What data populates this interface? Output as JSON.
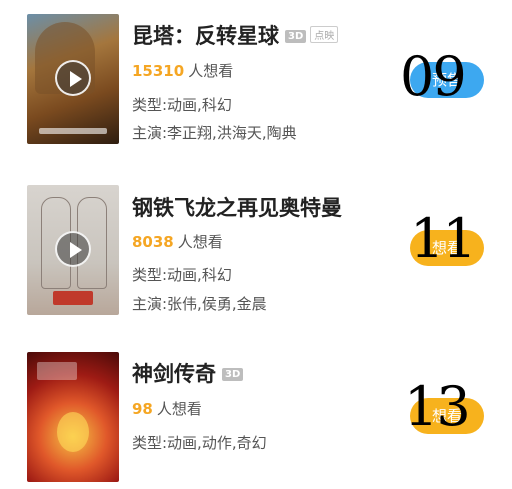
{
  "movies": [
    {
      "title": "昆塔：反转星球",
      "badge_3d": "3D",
      "badge_extra": "点映",
      "want_count": "15310",
      "want_suffix": "人想看",
      "genre": "类型:动画,科幻",
      "cast": "主演:李正翔,洪海天,陶典",
      "button_label": "预售",
      "big_number": "09",
      "button_color": "#3da8f0"
    },
    {
      "title": "钢铁飞龙之再见奥特曼",
      "want_count": "8038",
      "want_suffix": "人想看",
      "genre": "类型:动画,科幻",
      "cast": "主演:张伟,侯勇,金晨",
      "button_label": "想看",
      "big_number": "11",
      "button_color": "#f7b21d"
    },
    {
      "title": "神剑传奇",
      "badge_3d": "3D",
      "want_count": "98",
      "want_suffix": "人想看",
      "genre": "类型:动画,动作,奇幻",
      "button_label": "想看",
      "big_number": "13",
      "button_color": "#f7b21d"
    }
  ]
}
